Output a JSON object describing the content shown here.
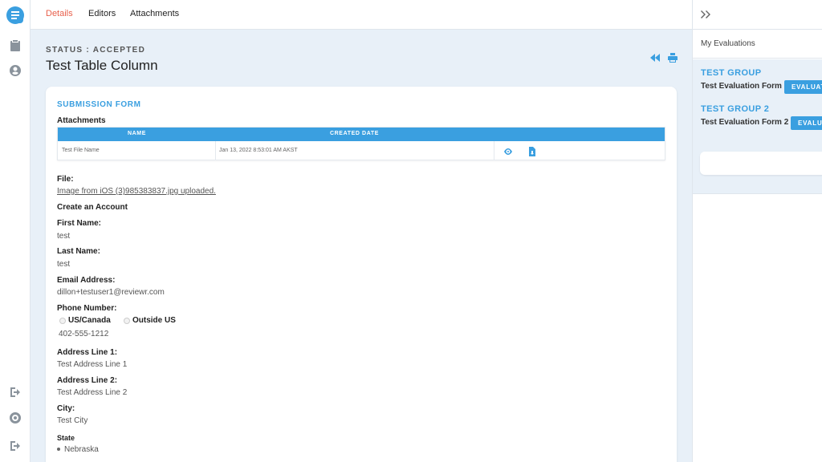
{
  "tabs": {
    "details": "Details",
    "editors": "Editors",
    "attachments": "Attachments"
  },
  "header": {
    "status": "STATUS : ACCEPTED",
    "title": "Test Table Column"
  },
  "form": {
    "title": "SUBMISSION FORM",
    "attachments_label": "Attachments",
    "table": {
      "col_name": "NAME",
      "col_date": "CREATED DATE",
      "row": {
        "name": "Test File Name",
        "date": "Jan 13, 2022 8:53:01 AM AKST"
      }
    },
    "file_label": "File:",
    "file_value": "Image from iOS (3)985383837.jpg uploaded.",
    "section": "Create an Account",
    "first_name_label": "First Name:",
    "first_name": "test",
    "last_name_label": "Last Name:",
    "last_name": "test",
    "email_label": "Email Address:",
    "email": "dillon+testuser1@reviewr.com",
    "phone_label": "Phone Number:",
    "phone_opt1": "US/Canada",
    "phone_opt2": "Outside US",
    "phone": "402-555-1212",
    "addr1_label": "Address Line 1:",
    "addr1": "Test Address Line 1",
    "addr2_label": "Address Line 2:",
    "addr2": "Test Address Line 2",
    "city_label": "City:",
    "city": "Test City",
    "state_label": "State",
    "state": "Nebraska"
  },
  "right_panel": {
    "section": "My Evaluations",
    "groups": [
      {
        "title": "TEST GROUP",
        "form": "Test Evaluation Form",
        "button": "EVALUATE"
      },
      {
        "title": "TEST GROUP 2",
        "form": "Test Evaluation Form 2",
        "button": "EVALUATE"
      }
    ]
  },
  "colors": {
    "accent": "#3a9fe0",
    "active_tab": "#e8604c",
    "background": "#e8f0f8"
  }
}
